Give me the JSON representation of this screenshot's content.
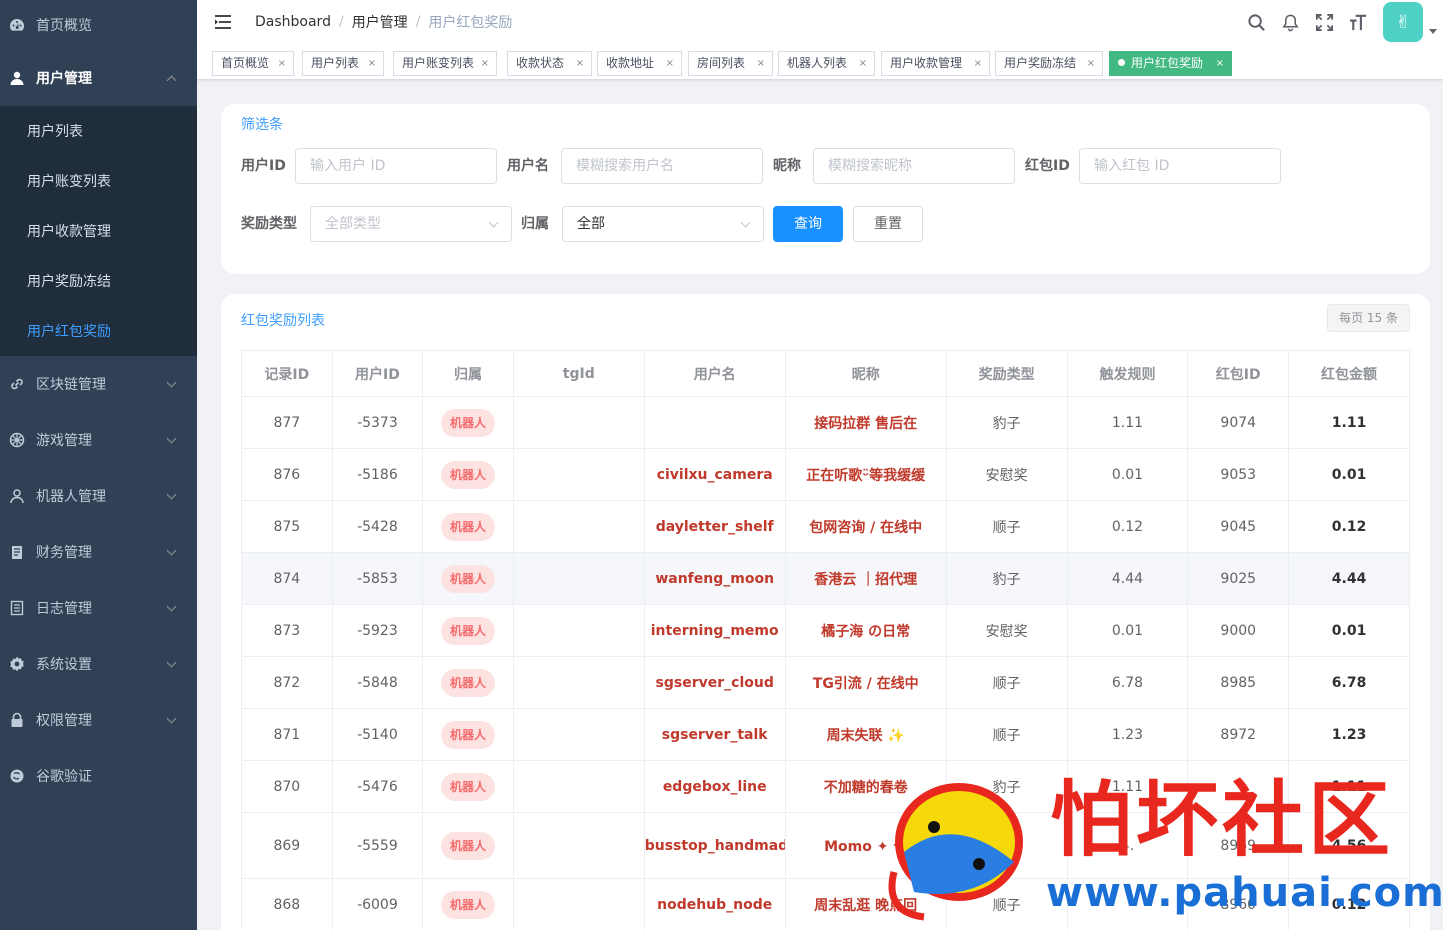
{
  "sidebar": {
    "top_item": {
      "label": "首页概览",
      "icon": "dashboard-icon"
    },
    "user_mgmt": {
      "label": "用户管理",
      "icon": "user-icon",
      "children": [
        {
          "label": "用户列表"
        },
        {
          "label": "用户账变列表"
        },
        {
          "label": "用户收款管理"
        },
        {
          "label": "用户奖励冻结"
        },
        {
          "label": "用户红包奖励"
        }
      ]
    },
    "groups": [
      {
        "label": "区块链管理",
        "icon": "chain-icon"
      },
      {
        "label": "游戏管理",
        "icon": "game-icon"
      },
      {
        "label": "机器人管理",
        "icon": "robot-icon"
      },
      {
        "label": "财务管理",
        "icon": "finance-icon"
      },
      {
        "label": "日志管理",
        "icon": "log-icon"
      },
      {
        "label": "系统设置",
        "icon": "gear-icon"
      },
      {
        "label": "权限管理",
        "icon": "lock-icon"
      },
      {
        "label": "谷歌验证",
        "icon": "google-icon"
      }
    ]
  },
  "breadcrumb": [
    "Dashboard",
    "用户管理",
    "用户红包奖励"
  ],
  "avatar_text": "✌",
  "tags": [
    {
      "label": "首页概览"
    },
    {
      "label": "用户列表"
    },
    {
      "label": "用户账变列表"
    },
    {
      "label": "收款状态"
    },
    {
      "label": "收款地址"
    },
    {
      "label": "房间列表"
    },
    {
      "label": "机器人列表"
    },
    {
      "label": "用户收款管理"
    },
    {
      "label": "用户奖励冻结"
    },
    {
      "label": "用户红包奖励"
    }
  ],
  "filter": {
    "title": "筛选条",
    "user_id_label": "用户ID",
    "user_id_placeholder": "输入用户 ID",
    "username_label": "用户名",
    "username_placeholder": "模糊搜索用户名",
    "nickname_label": "昵称",
    "nickname_placeholder": "模糊搜索昵称",
    "redpack_label": "红包ID",
    "redpack_placeholder": "输入红包 ID",
    "reward_type_label": "奖励类型",
    "reward_type_value": "全部类型",
    "owner_label": "归属",
    "owner_value": "全部",
    "query_label": "查询",
    "reset_label": "重置"
  },
  "list": {
    "title": "红包奖励列表",
    "page_size": "每页 15 条",
    "columns": [
      "记录ID",
      "用户ID",
      "归属",
      "tgId",
      "用户名",
      "昵称",
      "奖励类型",
      "触发规则",
      "红包ID",
      "红包金额"
    ],
    "rows": [
      {
        "id": "877",
        "uid": "-5373",
        "owner": "机器人",
        "tgid": "",
        "username": "",
        "nickname": "接码拉群 售后在",
        "type": "豹子",
        "rule": "1.11",
        "rpid": "9074",
        "amount": "1.11"
      },
      {
        "id": "876",
        "uid": "-5186",
        "owner": "机器人",
        "tgid": "",
        "username": "civilxu_camera",
        "nickname": "正在听歌ᵕ̈等我缓缓",
        "type": "安慰奖",
        "rule": "0.01",
        "rpid": "9053",
        "amount": "0.01"
      },
      {
        "id": "875",
        "uid": "-5428",
        "owner": "机器人",
        "tgid": "",
        "username": "dayletter_shelf",
        "nickname": "包网咨询 / 在线中",
        "type": "顺子",
        "rule": "0.12",
        "rpid": "9045",
        "amount": "0.12"
      },
      {
        "id": "874",
        "uid": "-5853",
        "owner": "机器人",
        "tgid": "",
        "username": "wanfeng_moon",
        "nickname": "香港云 ｜招代理",
        "type": "豹子",
        "rule": "4.44",
        "rpid": "9025",
        "amount": "4.44"
      },
      {
        "id": "873",
        "uid": "-5923",
        "owner": "机器人",
        "tgid": "",
        "username": "interning_memo",
        "nickname": "橘子海 の日常",
        "type": "安慰奖",
        "rule": "0.01",
        "rpid": "9000",
        "amount": "0.01"
      },
      {
        "id": "872",
        "uid": "-5848",
        "owner": "机器人",
        "tgid": "",
        "username": "sgserver_cloud",
        "nickname": "TG引流 / 在线中",
        "type": "顺子",
        "rule": "6.78",
        "rpid": "8985",
        "amount": "6.78"
      },
      {
        "id": "871",
        "uid": "-5140",
        "owner": "机器人",
        "tgid": "",
        "username": "sgserver_talk",
        "nickname": "周末失联 ✨",
        "type": "顺子",
        "rule": "1.23",
        "rpid": "8972",
        "amount": "1.23"
      },
      {
        "id": "870",
        "uid": "-5476",
        "owner": "机器人",
        "tgid": "",
        "username": "edgebox_line",
        "nickname": "不加糖的春卷",
        "type": "豹子",
        "rule": "1.11",
        "rpid": "",
        "amount": "1.11"
      },
      {
        "id": "869",
        "uid": "-5559",
        "owner": "机器人",
        "tgid": "",
        "username": "busstop_handmade",
        "nickname": "Momo ✦ 十",
        "type": "",
        "rule": "4.",
        "rpid": "8969",
        "amount": "4.56"
      },
      {
        "id": "868",
        "uid": "-6009",
        "owner": "机器人",
        "tgid": "",
        "username": "nodehub_node",
        "nickname": "周末乱逛 晚点回",
        "type": "顺子",
        "rule": "",
        "rpid": "8960",
        "amount": "0.12"
      }
    ]
  },
  "watermark": {
    "cn": "怕坏社区",
    "url": "www.pahuai.com"
  }
}
